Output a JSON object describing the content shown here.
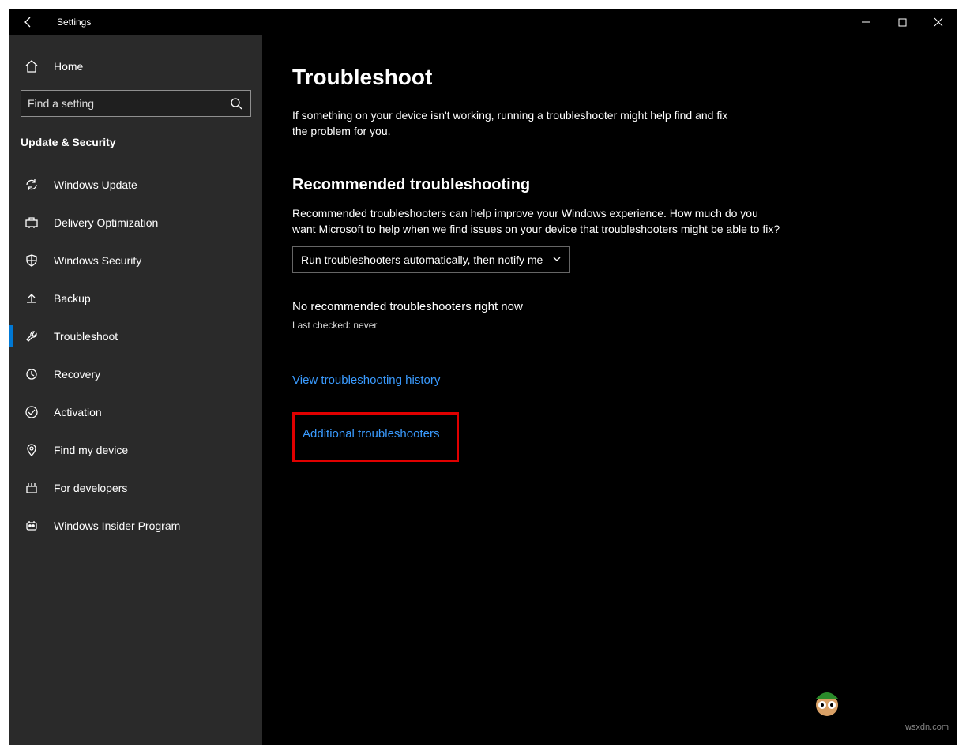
{
  "titlebar": {
    "title": "Settings"
  },
  "sidebar": {
    "home": "Home",
    "search_placeholder": "Find a setting",
    "category": "Update & Security",
    "items": [
      {
        "label": "Windows Update"
      },
      {
        "label": "Delivery Optimization"
      },
      {
        "label": "Windows Security"
      },
      {
        "label": "Backup"
      },
      {
        "label": "Troubleshoot"
      },
      {
        "label": "Recovery"
      },
      {
        "label": "Activation"
      },
      {
        "label": "Find my device"
      },
      {
        "label": "For developers"
      },
      {
        "label": "Windows Insider Program"
      }
    ]
  },
  "main": {
    "heading": "Troubleshoot",
    "intro": "If something on your device isn't working, running a troubleshooter might help find and fix the problem for you.",
    "section_heading": "Recommended troubleshooting",
    "section_desc": "Recommended troubleshooters can help improve your Windows experience. How much do you want Microsoft to help when we find issues on your device that troubleshooters might be able to fix?",
    "dropdown_value": "Run troubleshooters automatically, then notify me",
    "status": "No recommended troubleshooters right now",
    "substatus": "Last checked: never",
    "link_history": "View troubleshooting history",
    "link_additional": "Additional troubleshooters"
  },
  "watermark": "wsxdn.com"
}
